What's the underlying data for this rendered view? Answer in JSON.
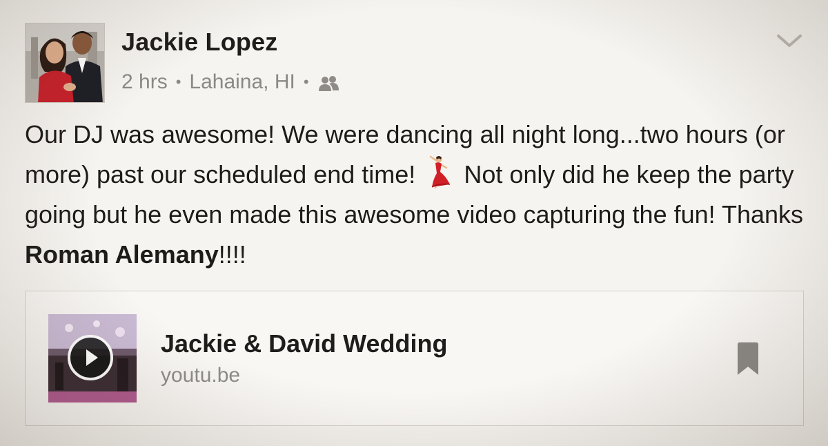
{
  "post": {
    "author": "Jackie Lopez",
    "time": "2 hrs",
    "separator": "•",
    "location": "Lahaina, HI",
    "audience_icon": "friends-icon",
    "menu_icon": "chevron-down-icon",
    "text_part1": "Our DJ was awesome!  We were dancing all night long...two hours (or more) past our scheduled end time! ",
    "emoji_icon": "dancer-emoji-icon",
    "text_part2": " Not only did he keep the party going but he even made this awesome video capturing the fun!  Thanks ",
    "mention": "Roman Alemany",
    "text_part3": "!!!!"
  },
  "link_card": {
    "title": "Jackie & David Wedding",
    "domain": "youtu.be",
    "play_icon": "play-icon",
    "save_icon": "bookmark-icon"
  },
  "colors": {
    "background": "#f6f4f0",
    "text": "#1e1c1a",
    "meta_text": "#8b8985",
    "icon_gray": "#8f8c88",
    "card_border": "#d6d2cb"
  }
}
